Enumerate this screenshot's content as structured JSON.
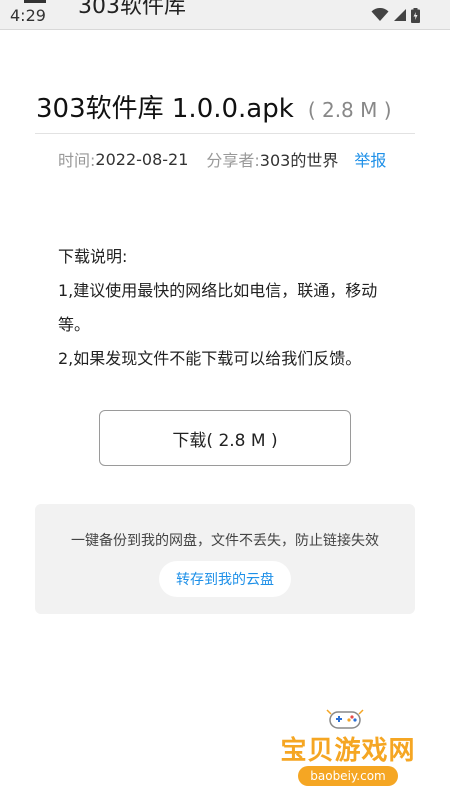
{
  "status_bar": {
    "time": "4:29",
    "app_title_peek": "303软件库"
  },
  "file": {
    "title": "303软件库 1.0.0.apk",
    "size": "( 2.8 M )"
  },
  "meta": {
    "time_label": "时间:",
    "time_value": "2022-08-21",
    "sharer_label": "分享者:",
    "sharer_value": "303的世界",
    "report_label": "举报"
  },
  "description": {
    "heading": "下载说明:",
    "line1": "1,建议使用最快的网络比如电信，联通，移动等。",
    "line2": "2,如果发现文件不能下载可以给我们反馈。"
  },
  "download_button": {
    "label": "下载( 2.8 M )"
  },
  "cloud": {
    "description": "一键备份到我的网盘，文件不丢失，防止链接失效",
    "button_label": "转存到我的云盘"
  },
  "watermark": {
    "text": "宝贝游戏网",
    "url": "baobeiy.com"
  },
  "colors": {
    "accent": "#1e90e8",
    "watermark": "#f5a623"
  }
}
